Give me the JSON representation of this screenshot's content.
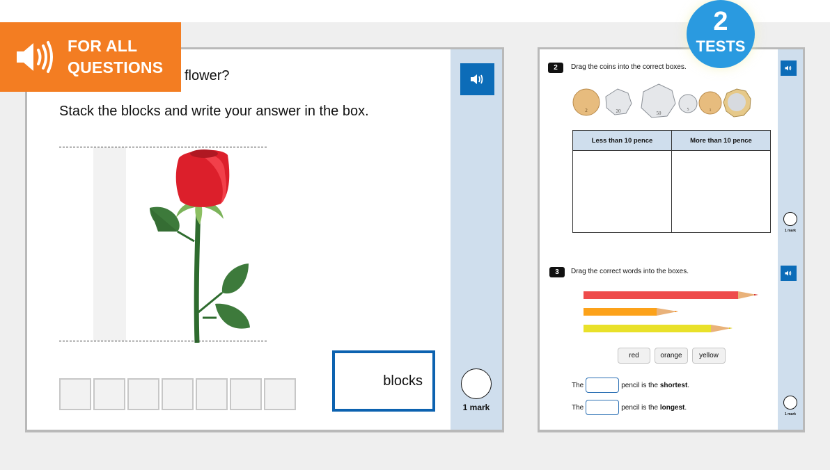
{
  "banner": {
    "icon": "speaker-icon",
    "line1": "FOR ALL",
    "line2": "QUESTIONS",
    "color": "#f37d22"
  },
  "badge": {
    "number": "2",
    "label": "TESTS",
    "color": "#2a9ae0"
  },
  "left_question": {
    "title_visible": "flower?",
    "instruction": "Stack the blocks and write your answer in the box.",
    "audio_icon": "speaker-icon",
    "image": "red-rose",
    "block_count": 7,
    "answer_suffix": "blocks",
    "mark_label": "1 mark",
    "accent": "#0c62b0"
  },
  "right_panel": {
    "q2": {
      "number": "2",
      "text": "Drag the coins into the correct boxes.",
      "coins": [
        "2p",
        "20p",
        "50p",
        "5p",
        "1p",
        "£1"
      ],
      "table_headers": [
        "Less than 10 pence",
        "More than 10 pence"
      ],
      "mark_label": "1 mark"
    },
    "q3": {
      "number": "3",
      "text": "Drag the correct words into the boxes.",
      "pencils": [
        "red",
        "orange",
        "yellow"
      ],
      "words": [
        "red",
        "orange",
        "yellow"
      ],
      "sentence1": {
        "prefix": "The",
        "middle": "pencil is the ",
        "bold": "shortest",
        "end": "."
      },
      "sentence2": {
        "prefix": "The",
        "middle": "pencil is the ",
        "bold": "longest",
        "end": "."
      },
      "mark_label": "1 mark"
    },
    "sidebar_color": "#cfdeed"
  }
}
